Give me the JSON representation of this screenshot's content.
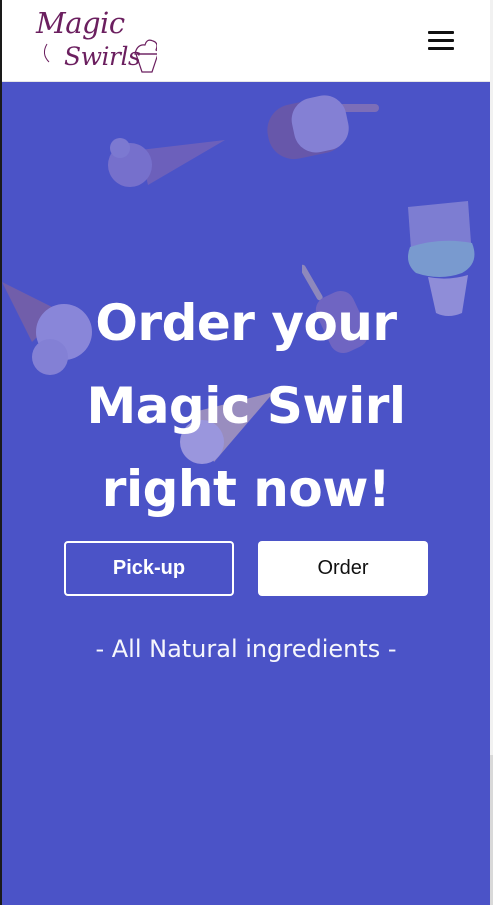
{
  "header": {
    "logo": {
      "line1": "Magic",
      "line2": "Swirls",
      "color": "#6b1f5f"
    },
    "menu_icon": "hamburger-menu-icon"
  },
  "hero": {
    "background": "#4b53c7",
    "title_line1": "Order your",
    "title_line2": "Magic Swirl",
    "title_line3": "right now!",
    "pickup_label": "Pick-up",
    "order_label": "Order",
    "tagline": "- All Natural ingredients -",
    "decorations": [
      "ice-cream-cone-icon",
      "popsicle-icon",
      "ice-cream-cup-icon",
      "ice-cream-cone-icon",
      "popsicle-icon",
      "ice-cream-cone-icon"
    ]
  }
}
